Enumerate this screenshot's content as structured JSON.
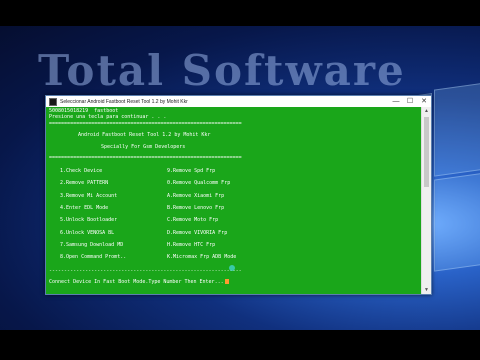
{
  "wallpaper": {
    "text": "Total Software"
  },
  "window": {
    "title": "Seleccionar Android Fastboot Reset Tool 1.2 by Mohit Kkr",
    "controls": {
      "minimize": "—",
      "maximize": "☐",
      "close": "✕"
    }
  },
  "console": {
    "device_line": "5008015018219  fastboot",
    "press_line": "Presione una tecla para continuar . . .",
    "divider": "================================================================",
    "header_title": "Android Fastboot Reset Tool 1.2 by Mohit Kkr",
    "header_sub": "Specially For Gsm Developers",
    "menu_left": [
      "1.Check Device",
      "2.Remove PATTERN",
      "3.Remove Mi Account",
      "4.Enter EDL Mode",
      "5.Unlock Bootloader",
      "6.Unlock VENOSA BL",
      "7.Samsung Download MD",
      "8.Open Command Promt.."
    ],
    "menu_right": [
      "9.Remove Spd Frp",
      "0.Remove Qualcomm Frp",
      "A.Remove Xiaomi Frp",
      "B.Remove Lenovo Frp",
      "C.Remove Moto Frp",
      "D.Remove VIVORIA Frp",
      "H.Remove HTC Frp",
      "K.Micromax Frp ADB Mode"
    ],
    "dash_divider": "----------------------------------------------------------------",
    "prompt": "Connect Device In Fast Boot Mode.Type Number Then Enter..."
  }
}
